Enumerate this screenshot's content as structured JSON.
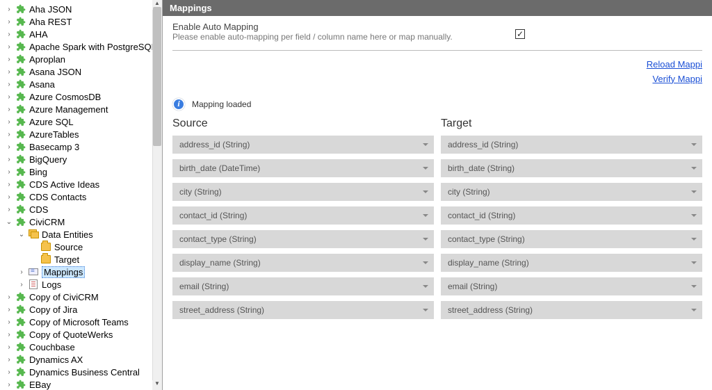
{
  "panel_title": "Mappings",
  "automap": {
    "title": "Enable Auto Mapping",
    "subtitle": "Please enable auto-mapping per field / column name here or map manually.",
    "checked": true
  },
  "links": {
    "reload": "Reload Mappi",
    "verify": "Verify Mappi"
  },
  "status": {
    "icon_glyph": "i",
    "text": "Mapping loaded"
  },
  "columns": {
    "source_header": "Source",
    "target_header": "Target"
  },
  "mappings": [
    {
      "source": "address_id (String)",
      "target": "address_id (String)"
    },
    {
      "source": "birth_date (DateTime)",
      "target": "birth_date (String)"
    },
    {
      "source": "city (String)",
      "target": "city (String)"
    },
    {
      "source": "contact_id (String)",
      "target": "contact_id (String)"
    },
    {
      "source": "contact_type (String)",
      "target": "contact_type (String)"
    },
    {
      "source": "display_name (String)",
      "target": "display_name (String)"
    },
    {
      "source": "email (String)",
      "target": "email (String)"
    },
    {
      "source": "street_address (String)",
      "target": "street_address (String)"
    }
  ],
  "tree": [
    {
      "lvl": 0,
      "expand": ">",
      "icon": "puzzle",
      "label": "Aha JSON"
    },
    {
      "lvl": 0,
      "expand": ">",
      "icon": "puzzle",
      "label": "Aha REST"
    },
    {
      "lvl": 0,
      "expand": ">",
      "icon": "puzzle",
      "label": "AHA"
    },
    {
      "lvl": 0,
      "expand": ">",
      "icon": "puzzle",
      "label": "Apache Spark with PostgreSQL"
    },
    {
      "lvl": 0,
      "expand": ">",
      "icon": "puzzle",
      "label": "Aproplan"
    },
    {
      "lvl": 0,
      "expand": ">",
      "icon": "puzzle",
      "label": "Asana JSON"
    },
    {
      "lvl": 0,
      "expand": ">",
      "icon": "puzzle",
      "label": "Asana"
    },
    {
      "lvl": 0,
      "expand": ">",
      "icon": "puzzle",
      "label": "Azure CosmosDB"
    },
    {
      "lvl": 0,
      "expand": ">",
      "icon": "puzzle",
      "label": "Azure Management"
    },
    {
      "lvl": 0,
      "expand": ">",
      "icon": "puzzle",
      "label": "Azure SQL"
    },
    {
      "lvl": 0,
      "expand": ">",
      "icon": "puzzle",
      "label": "AzureTables"
    },
    {
      "lvl": 0,
      "expand": ">",
      "icon": "puzzle",
      "label": "Basecamp 3"
    },
    {
      "lvl": 0,
      "expand": ">",
      "icon": "puzzle",
      "label": "BigQuery"
    },
    {
      "lvl": 0,
      "expand": ">",
      "icon": "puzzle",
      "label": "Bing"
    },
    {
      "lvl": 0,
      "expand": ">",
      "icon": "puzzle",
      "label": "CDS Active Ideas"
    },
    {
      "lvl": 0,
      "expand": ">",
      "icon": "puzzle",
      "label": "CDS Contacts"
    },
    {
      "lvl": 0,
      "expand": ">",
      "icon": "puzzle",
      "label": "CDS"
    },
    {
      "lvl": 0,
      "expand": "v",
      "icon": "puzzle",
      "label": "CiviCRM"
    },
    {
      "lvl": 1,
      "expand": "v",
      "icon": "folderstack",
      "label": "Data Entities"
    },
    {
      "lvl": 2,
      "expand": "",
      "icon": "folder",
      "label": "Source"
    },
    {
      "lvl": 2,
      "expand": "",
      "icon": "folder",
      "label": "Target"
    },
    {
      "lvl": 1,
      "expand": ">",
      "icon": "mapping",
      "label": "Mappings",
      "selected": true
    },
    {
      "lvl": 1,
      "expand": ">",
      "icon": "logs",
      "label": "Logs"
    },
    {
      "lvl": 0,
      "expand": ">",
      "icon": "puzzle",
      "label": "Copy of CiviCRM"
    },
    {
      "lvl": 0,
      "expand": ">",
      "icon": "puzzle",
      "label": "Copy of Jira"
    },
    {
      "lvl": 0,
      "expand": ">",
      "icon": "puzzle",
      "label": "Copy of Microsoft Teams"
    },
    {
      "lvl": 0,
      "expand": ">",
      "icon": "puzzle",
      "label": "Copy of QuoteWerks"
    },
    {
      "lvl": 0,
      "expand": ">",
      "icon": "puzzle",
      "label": "Couchbase"
    },
    {
      "lvl": 0,
      "expand": ">",
      "icon": "puzzle",
      "label": "Dynamics AX"
    },
    {
      "lvl": 0,
      "expand": ">",
      "icon": "puzzle",
      "label": "Dynamics Business Central"
    },
    {
      "lvl": 0,
      "expand": ">",
      "icon": "puzzle",
      "label": "EBay"
    }
  ]
}
